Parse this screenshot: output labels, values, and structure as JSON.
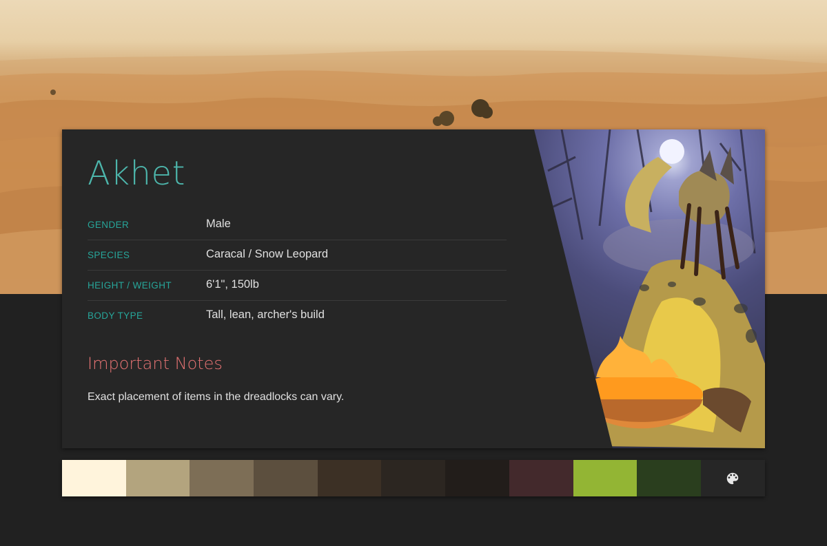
{
  "character": {
    "name": "Akhet",
    "stats": [
      {
        "label": "GENDER",
        "value": "Male"
      },
      {
        "label": "SPECIES",
        "value": "Caracal / Snow Leopard"
      },
      {
        "label": "HEIGHT / WEIGHT",
        "value": "6'1\", 150lb"
      },
      {
        "label": "BODY TYPE",
        "value": "Tall, lean, archer's build"
      }
    ],
    "notes": {
      "title": "Important Notes",
      "text": "Exact placement of items in the dreadlocks can vary."
    }
  },
  "palette": {
    "colors": [
      "#fff4dc",
      "#b3a47e",
      "#7d6e56",
      "#5c4f3e",
      "#3c3025",
      "#2c2621",
      "#221d1a",
      "#43292c",
      "#93b534",
      "#2a3e1e"
    ],
    "icon": "palette-icon"
  },
  "theme": {
    "accent": "#26a69a",
    "heading": "#4db6ac",
    "notes_heading": "#e57373",
    "card_bg": "#262626",
    "page_bg": "#212121"
  }
}
